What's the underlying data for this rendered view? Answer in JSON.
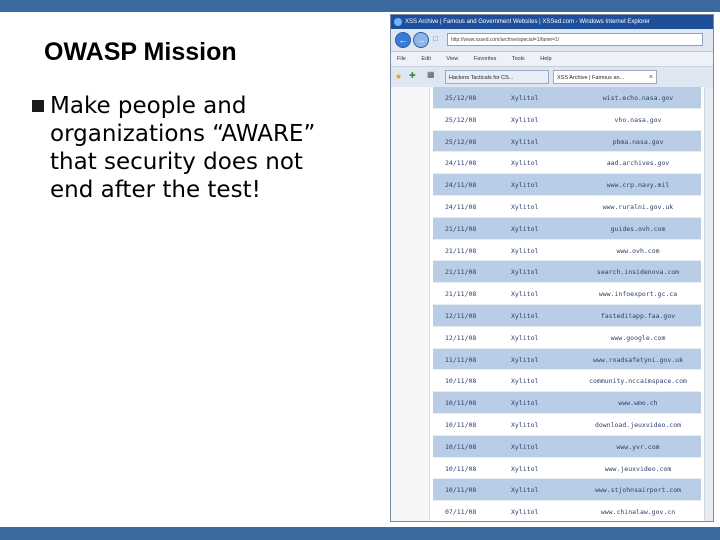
{
  "slide": {
    "title": "OWASP Mission",
    "bullet": "Make people and\norganizations “AWARE”\nthat security does not\nend after the test!"
  },
  "browser": {
    "window_title": "XSS Archive | Famous and Government Websites | XSSed.com - Windows Internet Explorer",
    "address": "http://www.xssed.com/archive/special=1/fame=1/",
    "menu": [
      "File",
      "Edit",
      "View",
      "Favorites",
      "Tools",
      "Help"
    ],
    "tabs": [
      {
        "label": "Hackers Tacticals for CS..."
      },
      {
        "label": "XSS Archive | Famous an..."
      }
    ],
    "rows": [
      {
        "date": "25/12/08",
        "author": "Xylitol",
        "site": "wist.echo.nasa.gov"
      },
      {
        "date": "25/12/08",
        "author": "Xylitol",
        "site": "vho.nasa.gov"
      },
      {
        "date": "25/12/08",
        "author": "Xylitol",
        "site": "pbma.nasa.gov"
      },
      {
        "date": "24/11/08",
        "author": "Xylitol",
        "site": "aad.archives.gov"
      },
      {
        "date": "24/11/08",
        "author": "Xylitol",
        "site": "www.crp.navy.mil"
      },
      {
        "date": "24/11/08",
        "author": "Xylitol",
        "site": "www.ruralni.gov.uk"
      },
      {
        "date": "21/11/08",
        "author": "Xylitol",
        "site": "guides.ovh.com"
      },
      {
        "date": "21/11/08",
        "author": "Xylitol",
        "site": "www.ovh.com"
      },
      {
        "date": "21/11/08",
        "author": "Xylitol",
        "site": "search.insidenova.com"
      },
      {
        "date": "21/11/08",
        "author": "Xylitol",
        "site": "www.infoexport.gc.ca"
      },
      {
        "date": "12/11/08",
        "author": "Xylitol",
        "site": "fasteditapp.faa.gov"
      },
      {
        "date": "12/11/08",
        "author": "Xylitol",
        "site": "www.google.com"
      },
      {
        "date": "11/11/08",
        "author": "Xylitol",
        "site": "www.roadsafetyni.gov.uk"
      },
      {
        "date": "10/11/08",
        "author": "Xylitol",
        "site": "community.nccaimspace.com"
      },
      {
        "date": "10/11/08",
        "author": "Xylitol",
        "site": "www.wmo.ch"
      },
      {
        "date": "10/11/08",
        "author": "Xylitol",
        "site": "download.jeuxvideo.com"
      },
      {
        "date": "10/11/08",
        "author": "Xylitol",
        "site": "www.yvr.com"
      },
      {
        "date": "10/11/08",
        "author": "Xylitol",
        "site": "www.jeuxvideo.com"
      },
      {
        "date": "10/11/08",
        "author": "Xylitol",
        "site": "www.stjohnsairport.com"
      },
      {
        "date": "07/11/08",
        "author": "Xylitol",
        "site": "www.chinalaw.gov.cn"
      }
    ]
  },
  "colors": {
    "slide_bar": "#3d6a9e",
    "row_alt": "#b9cde6",
    "ie_title": "#1f4f9a"
  }
}
